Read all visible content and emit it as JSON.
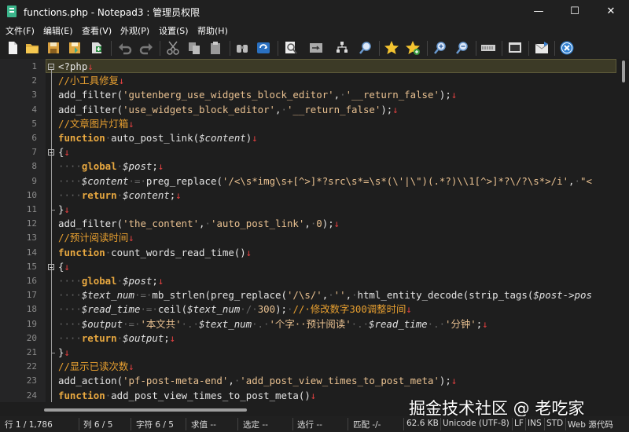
{
  "window": {
    "title": "functions.php - Notepad3 : 管理员权限",
    "minimize": "—",
    "maximize": "☐",
    "close": "✕"
  },
  "menu": [
    "文件(F)",
    "编辑(E)",
    "查看(V)",
    "外观(P)",
    "设置(S)",
    "帮助(H)"
  ],
  "toolbar_icons": [
    "new-file-icon",
    "open-folder-icon",
    "save-icon",
    "save-as-icon",
    "save-copy-icon",
    "undo-icon",
    "redo-icon",
    "cut-icon",
    "copy-icon",
    "paste-icon",
    "find-icon",
    "replace-icon",
    "find-in-files-icon",
    "word-wrap-icon",
    "scheme-icon",
    "zoom-icon",
    "favorite-icon",
    "add-favorite-icon",
    "zoom-in-icon",
    "zoom-out-icon",
    "encoding-icon",
    "screen-icon",
    "send-icon",
    "close-file-icon"
  ],
  "code": {
    "line_numbers": [
      "1",
      "2",
      "3",
      "4",
      "5",
      "6",
      "7",
      "8",
      "9",
      "10",
      "11",
      "12",
      "13",
      "14",
      "15",
      "16",
      "17",
      "18",
      "19",
      "20",
      "21",
      "22",
      "23",
      "24"
    ],
    "current_line": 1,
    "lines": [
      [
        {
          "t": "<?php",
          "c": "p"
        },
        {
          "t": "↓",
          "c": "a"
        }
      ],
      [
        {
          "t": "//小工具修复",
          "c": "c"
        },
        {
          "t": "↓",
          "c": "a"
        }
      ],
      [
        {
          "t": "add_filter(",
          "c": "p"
        },
        {
          "t": "'gutenberg_use_widgets_block_editor'",
          "c": "s"
        },
        {
          "t": ",",
          "c": "p"
        },
        {
          "t": "·",
          "c": "d"
        },
        {
          "t": "'__return_false'",
          "c": "s"
        },
        {
          "t": ");",
          "c": "p"
        },
        {
          "t": "↓",
          "c": "a"
        }
      ],
      [
        {
          "t": "add_filter(",
          "c": "p"
        },
        {
          "t": "'use_widgets_block_editor'",
          "c": "s"
        },
        {
          "t": ",",
          "c": "p"
        },
        {
          "t": "·",
          "c": "d"
        },
        {
          "t": "'__return_false'",
          "c": "s"
        },
        {
          "t": ");",
          "c": "p"
        },
        {
          "t": "↓",
          "c": "a"
        }
      ],
      [
        {
          "t": "//文章图片灯箱",
          "c": "c"
        },
        {
          "t": "↓",
          "c": "a"
        }
      ],
      [
        {
          "t": "function",
          "c": "k"
        },
        {
          "t": "·",
          "c": "d"
        },
        {
          "t": "auto_post_link(",
          "c": "p"
        },
        {
          "t": "$content",
          "c": "v"
        },
        {
          "t": ")",
          "c": "p"
        },
        {
          "t": "↓",
          "c": "a"
        }
      ],
      [
        {
          "t": "{",
          "c": "p"
        },
        {
          "t": "↓",
          "c": "a"
        }
      ],
      [
        {
          "t": "····",
          "c": "d"
        },
        {
          "t": "global",
          "c": "k"
        },
        {
          "t": "·",
          "c": "d"
        },
        {
          "t": "$post",
          "c": "v"
        },
        {
          "t": ";",
          "c": "p"
        },
        {
          "t": "↓",
          "c": "a"
        }
      ],
      [
        {
          "t": "····",
          "c": "d"
        },
        {
          "t": "$content",
          "c": "v"
        },
        {
          "t": "·=·",
          "c": "d"
        },
        {
          "t": "preg_replace(",
          "c": "p"
        },
        {
          "t": "'/<\\s*img\\s+[^>]*?src\\s*=\\s*(\\'|\\\")(.*?)\\\\1[^>]*?\\/?\\s*>/i'",
          "c": "s"
        },
        {
          "t": ",",
          "c": "p"
        },
        {
          "t": "·",
          "c": "d"
        },
        {
          "t": "\"<",
          "c": "s"
        }
      ],
      [
        {
          "t": "····",
          "c": "d"
        },
        {
          "t": "return",
          "c": "k"
        },
        {
          "t": "·",
          "c": "d"
        },
        {
          "t": "$content",
          "c": "v"
        },
        {
          "t": ";",
          "c": "p"
        },
        {
          "t": "↓",
          "c": "a"
        }
      ],
      [
        {
          "t": "}",
          "c": "p"
        },
        {
          "t": "↓",
          "c": "a"
        }
      ],
      [
        {
          "t": "add_filter(",
          "c": "p"
        },
        {
          "t": "'the_content'",
          "c": "s"
        },
        {
          "t": ",",
          "c": "p"
        },
        {
          "t": "·",
          "c": "d"
        },
        {
          "t": "'auto_post_link'",
          "c": "s"
        },
        {
          "t": ",",
          "c": "p"
        },
        {
          "t": "·",
          "c": "d"
        },
        {
          "t": "0",
          "c": "s"
        },
        {
          "t": ");",
          "c": "p"
        },
        {
          "t": "↓",
          "c": "a"
        }
      ],
      [
        {
          "t": "//预计阅读时间",
          "c": "c"
        },
        {
          "t": "↓",
          "c": "a"
        }
      ],
      [
        {
          "t": "function",
          "c": "k"
        },
        {
          "t": "·",
          "c": "d"
        },
        {
          "t": "count_words_read_time()",
          "c": "p"
        },
        {
          "t": "↓",
          "c": "a"
        }
      ],
      [
        {
          "t": "{",
          "c": "p"
        },
        {
          "t": "↓",
          "c": "a"
        }
      ],
      [
        {
          "t": "····",
          "c": "d"
        },
        {
          "t": "global",
          "c": "k"
        },
        {
          "t": "·",
          "c": "d"
        },
        {
          "t": "$post",
          "c": "v"
        },
        {
          "t": ";",
          "c": "p"
        },
        {
          "t": "↓",
          "c": "a"
        }
      ],
      [
        {
          "t": "····",
          "c": "d"
        },
        {
          "t": "$text_num",
          "c": "v"
        },
        {
          "t": "·=·",
          "c": "d"
        },
        {
          "t": "mb_strlen(preg_replace(",
          "c": "p"
        },
        {
          "t": "'/\\s/'",
          "c": "s"
        },
        {
          "t": ",",
          "c": "p"
        },
        {
          "t": "·",
          "c": "d"
        },
        {
          "t": "''",
          "c": "s"
        },
        {
          "t": ",",
          "c": "p"
        },
        {
          "t": "·",
          "c": "d"
        },
        {
          "t": "html_entity_decode(strip_tags(",
          "c": "p"
        },
        {
          "t": "$post->pos",
          "c": "v"
        }
      ],
      [
        {
          "t": "····",
          "c": "d"
        },
        {
          "t": "$read_time",
          "c": "v"
        },
        {
          "t": "·=·",
          "c": "d"
        },
        {
          "t": "ceil(",
          "c": "p"
        },
        {
          "t": "$text_num",
          "c": "v"
        },
        {
          "t": "·/·",
          "c": "d"
        },
        {
          "t": "300",
          "c": "s"
        },
        {
          "t": ");",
          "c": "p"
        },
        {
          "t": "·",
          "c": "d"
        },
        {
          "t": "//·修改数字300调整时间",
          "c": "c"
        },
        {
          "t": "↓",
          "c": "a"
        }
      ],
      [
        {
          "t": "····",
          "c": "d"
        },
        {
          "t": "$output",
          "c": "v"
        },
        {
          "t": "·=·",
          "c": "d"
        },
        {
          "t": "'本文共'",
          "c": "s"
        },
        {
          "t": "·.·",
          "c": "d"
        },
        {
          "t": "$text_num",
          "c": "v"
        },
        {
          "t": "·.·",
          "c": "d"
        },
        {
          "t": "'个字··预计阅读'",
          "c": "s"
        },
        {
          "t": "·.·",
          "c": "d"
        },
        {
          "t": "$read_time",
          "c": "v"
        },
        {
          "t": "·.·",
          "c": "d"
        },
        {
          "t": "'分钟'",
          "c": "s"
        },
        {
          "t": ";",
          "c": "p"
        },
        {
          "t": "↓",
          "c": "a"
        }
      ],
      [
        {
          "t": "····",
          "c": "d"
        },
        {
          "t": "return",
          "c": "k"
        },
        {
          "t": "·",
          "c": "d"
        },
        {
          "t": "$output",
          "c": "v"
        },
        {
          "t": ";",
          "c": "p"
        },
        {
          "t": "↓",
          "c": "a"
        }
      ],
      [
        {
          "t": "}",
          "c": "p"
        },
        {
          "t": "↓",
          "c": "a"
        }
      ],
      [
        {
          "t": "//显示已读次数",
          "c": "c"
        },
        {
          "t": "↓",
          "c": "a"
        }
      ],
      [
        {
          "t": "add_action(",
          "c": "p"
        },
        {
          "t": "'pf-post-meta-end'",
          "c": "s"
        },
        {
          "t": ",",
          "c": "p"
        },
        {
          "t": "·",
          "c": "d"
        },
        {
          "t": "'add_post_view_times_to_post_meta'",
          "c": "s"
        },
        {
          "t": ");",
          "c": "p"
        },
        {
          "t": "↓",
          "c": "a"
        }
      ],
      [
        {
          "t": "function",
          "c": "k"
        },
        {
          "t": "·",
          "c": "d"
        },
        {
          "t": "add_post_view_times_to_post_meta()",
          "c": "p"
        },
        {
          "t": "↓",
          "c": "a"
        }
      ]
    ]
  },
  "status": {
    "line": "行 1 / 1,786",
    "col": "列 6 / 5",
    "char": "字符 6 / 5",
    "value": "求值 --",
    "select": "选定 --",
    "rows": "选行 --",
    "match": "匹配 -/-",
    "size": "62.6 KB",
    "encoding": "Unicode (UTF-8)",
    "eol": "LF",
    "ins": "INS",
    "std": "STD",
    "lexer": "Web 源代码"
  },
  "watermark": "掘金技术社区 @ 老吃家",
  "colors": {
    "keyword": "#e8a840",
    "string": "#e8c090",
    "comment": "#e8a030",
    "variable": "#e0e0e0",
    "eol_arrow": "#e04040",
    "current_line": "#3c3a26"
  }
}
